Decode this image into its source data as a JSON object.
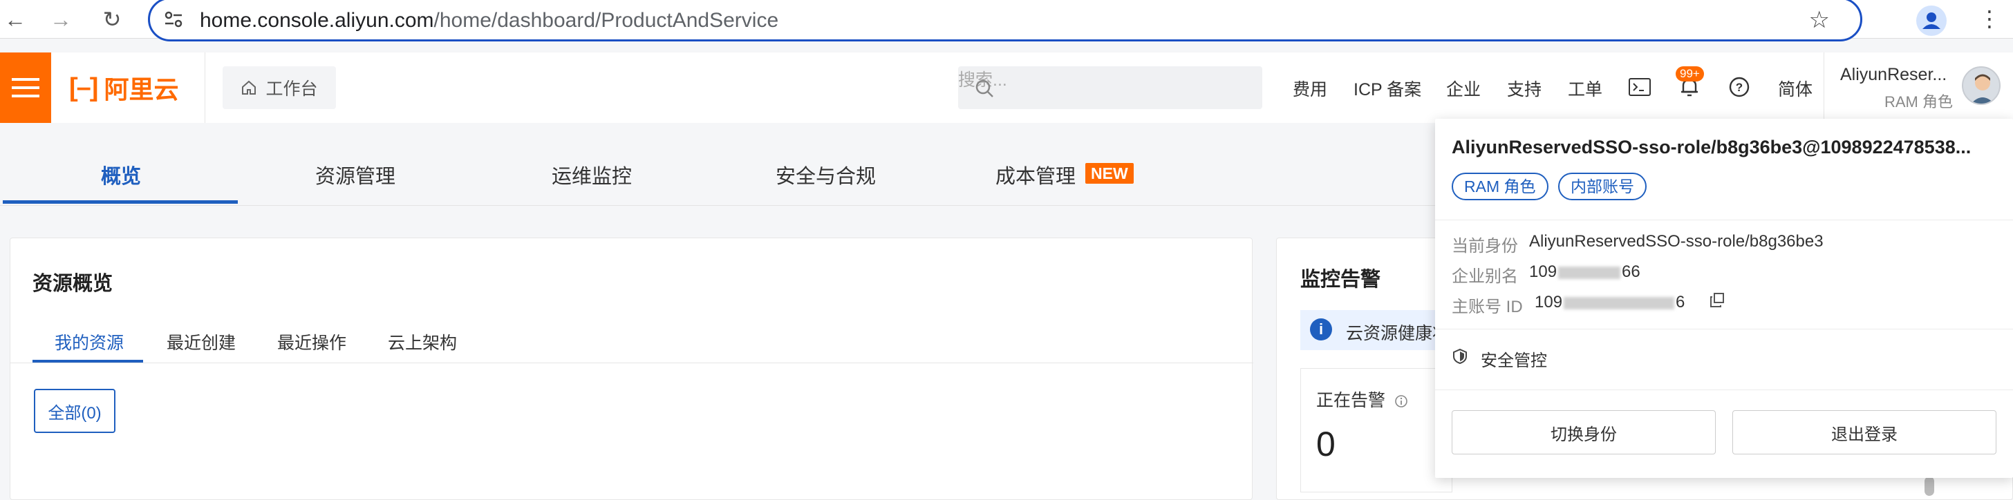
{
  "browser": {
    "url_host": "home.console.aliyun.com",
    "url_path": "/home/dashboard/ProductAndService"
  },
  "header": {
    "logo_text": "阿里云",
    "workbench": "工作台",
    "search_placeholder": "搜索...",
    "links": [
      "费用",
      "ICP 备案",
      "企业",
      "支持",
      "工单"
    ],
    "notification_badge": "99+",
    "language": "简体",
    "user_name": "AliyunReser...",
    "user_role": "RAM 角色"
  },
  "main_tabs": {
    "overview": "概览",
    "resources": "资源管理",
    "ops": "运维监控",
    "security": "安全与合规",
    "cost": "成本管理",
    "new_badge": "NEW"
  },
  "resource_card": {
    "title": "资源概览",
    "tabs": [
      "我的资源",
      "最近创建",
      "最近操作",
      "云上架构"
    ],
    "all_button": "全部(0)"
  },
  "monitor_card": {
    "title": "监控告警",
    "info_text": "云资源健康状",
    "alarm_label": "正在告警",
    "alarm_value": "0"
  },
  "dropdown": {
    "user_full": "AliyunReservedSSO-sso-role/b8g36be3@1098922478538...",
    "tags": [
      "RAM 角色",
      "内部账号"
    ],
    "identity_label": "当前身份",
    "identity_value": "AliyunReservedSSO-sso-role/b8g36be3",
    "alias_label": "企业别名",
    "alias_prefix": "109",
    "alias_suffix": "66",
    "account_label": "主账号 ID",
    "account_prefix": "109",
    "account_suffix": "6",
    "security": "安全管控",
    "switch_button": "切换身份",
    "logout_button": "退出登录"
  },
  "colors": {
    "brand": "#ff6a00",
    "primary": "#1f5fbf"
  }
}
